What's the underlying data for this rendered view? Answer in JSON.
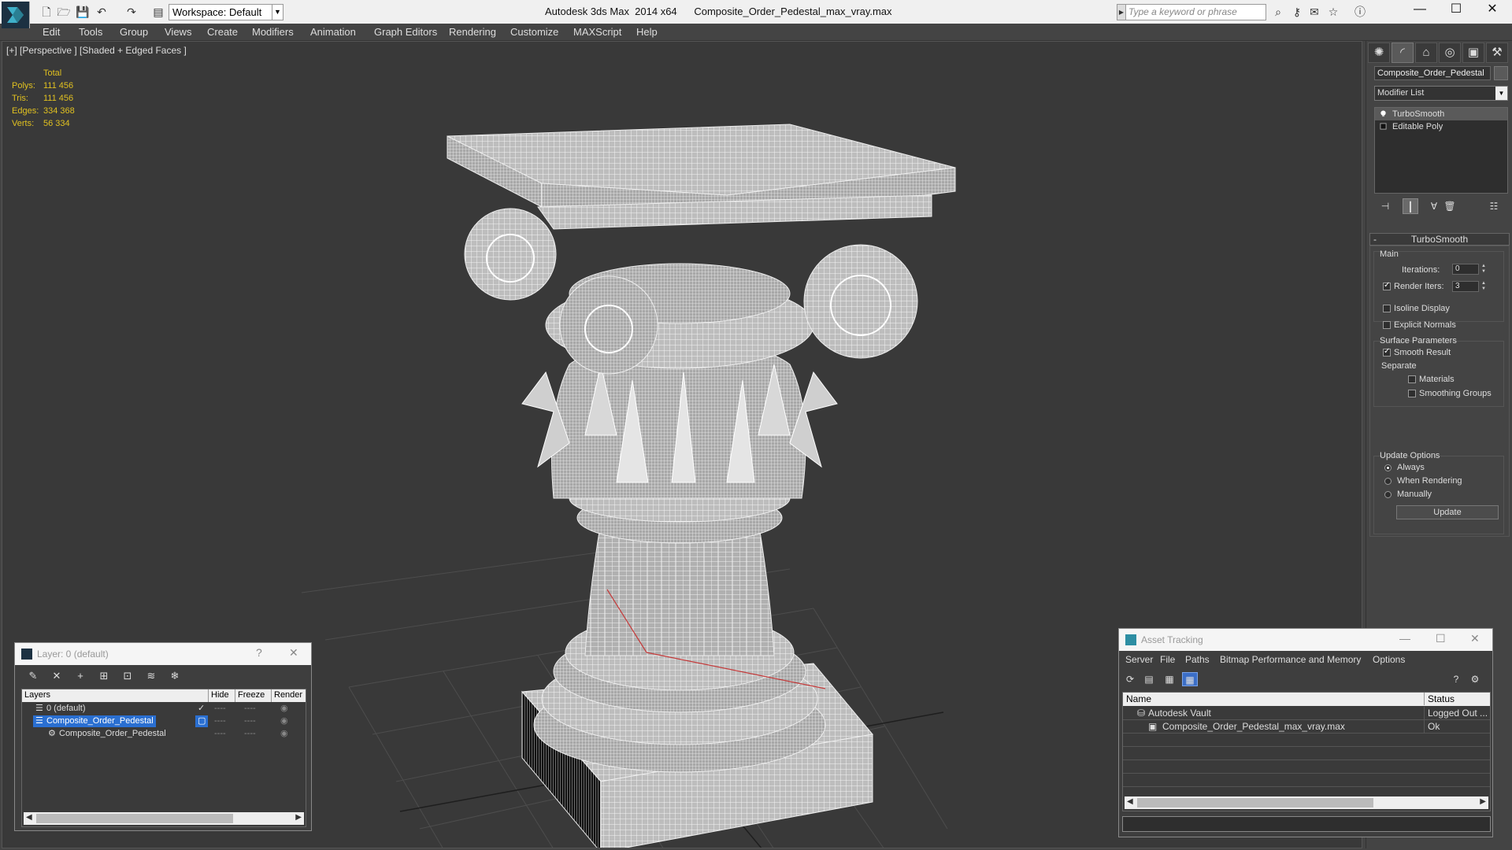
{
  "titlebar": {
    "workspace": "Workspace: Default",
    "title": "Autodesk 3ds Max  2014 x64      Composite_Order_Pedestal_max_vray.max",
    "search_placeholder": "Type a keyword or phrase",
    "minimize": "—",
    "maximize": "☐",
    "close": "✕"
  },
  "menu": [
    "Edit",
    "Tools",
    "Group",
    "Views",
    "Create",
    "Modifiers",
    "Animation",
    "Graph Editors",
    "Rendering",
    "Customize",
    "MAXScript",
    "Help"
  ],
  "viewport": {
    "label": "[+] [Perspective ] [Shaded + Edged Faces ]",
    "stats_header": "Total",
    "stats": [
      {
        "label": "Polys:",
        "value": "111 456"
      },
      {
        "label": "Tris:",
        "value": "111 456"
      },
      {
        "label": "Edges:",
        "value": "334 368"
      },
      {
        "label": "Verts:",
        "value": "56 334"
      }
    ]
  },
  "cmdpanel": {
    "tabs": [
      "✺",
      "◜",
      "⌂",
      "◎",
      "▣",
      "⚒"
    ],
    "object_name": "Composite_Order_Pedestal",
    "modifier_list": "Modifier List",
    "stack": [
      "TurboSmooth",
      "Editable Poly"
    ],
    "turbosmooth": {
      "title": "TurboSmooth",
      "main": "Main",
      "iterations_label": "Iterations:",
      "iterations_value": "0",
      "render_iters_label": "Render Iters:",
      "render_iters_value": "3",
      "isoline": "Isoline Display",
      "explicit_normals": "Explicit Normals",
      "surface_params": "Surface Parameters",
      "smooth_result": "Smooth Result",
      "separate": "Separate",
      "materials": "Materials",
      "smoothing_groups": "Smoothing Groups",
      "update_options": "Update Options",
      "always": "Always",
      "when_rendering": "When Rendering",
      "manually": "Manually",
      "update_button": "Update"
    }
  },
  "layer_dialog": {
    "title": "Layer: 0 (default)",
    "help": "?",
    "close": "✕",
    "columns": [
      "Layers",
      "Hide",
      "Freeze",
      "Render"
    ],
    "rows": [
      {
        "name": "0 (default)"
      },
      {
        "name": "Composite_Order_Pedestal"
      },
      {
        "name": "Composite_Order_Pedestal"
      }
    ],
    "dash": "----"
  },
  "asset_dialog": {
    "title": "Asset Tracking",
    "menu": [
      "Server",
      "File",
      "Paths",
      "Bitmap Performance and Memory",
      "Options"
    ],
    "columns": [
      "Name",
      "Status"
    ],
    "rows": [
      {
        "name": "Autodesk Vault",
        "status": "Logged Out ..."
      },
      {
        "name": "Composite_Order_Pedestal_max_vray.max",
        "status": "Ok"
      }
    ]
  }
}
